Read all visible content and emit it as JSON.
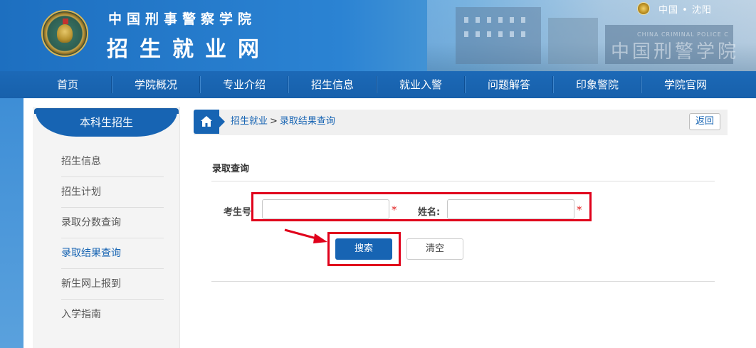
{
  "header": {
    "title_top": "中国刑事警察学院",
    "title_main": "招生就业网",
    "location": "中国 • 沈阳",
    "campus_text": "中国刑警学院",
    "campus_subtext": "CHINA CRIMINAL POLICE C"
  },
  "nav": {
    "items": [
      "首页",
      "学院概况",
      "专业介绍",
      "招生信息",
      "就业入警",
      "问题解答",
      "印象警院",
      "学院官网"
    ]
  },
  "sidebar": {
    "title": "本科生招生",
    "items": [
      "招生信息",
      "招生计划",
      "录取分数查询",
      "录取结果查询",
      "新生网上报到",
      "入学指南"
    ],
    "active_index": 3
  },
  "breadcrumb": {
    "parent": "招生就业",
    "separator": ">",
    "current": "录取结果查询",
    "back_label": "返回"
  },
  "form": {
    "section_title": "录取查询",
    "exam_no_label": "考生号",
    "exam_no_value": "",
    "name_label": "姓名:",
    "name_value": "",
    "required_mark": "*",
    "search_label": "搜索",
    "clear_label": "清空"
  },
  "colors": {
    "primary": "#1764b3",
    "highlight": "#e0001b",
    "required": "#e02020"
  },
  "icons": {
    "home": "home-icon",
    "emblem": "police-emblem-icon",
    "location": "location-badge-icon",
    "arrow": "arrow-icon"
  }
}
